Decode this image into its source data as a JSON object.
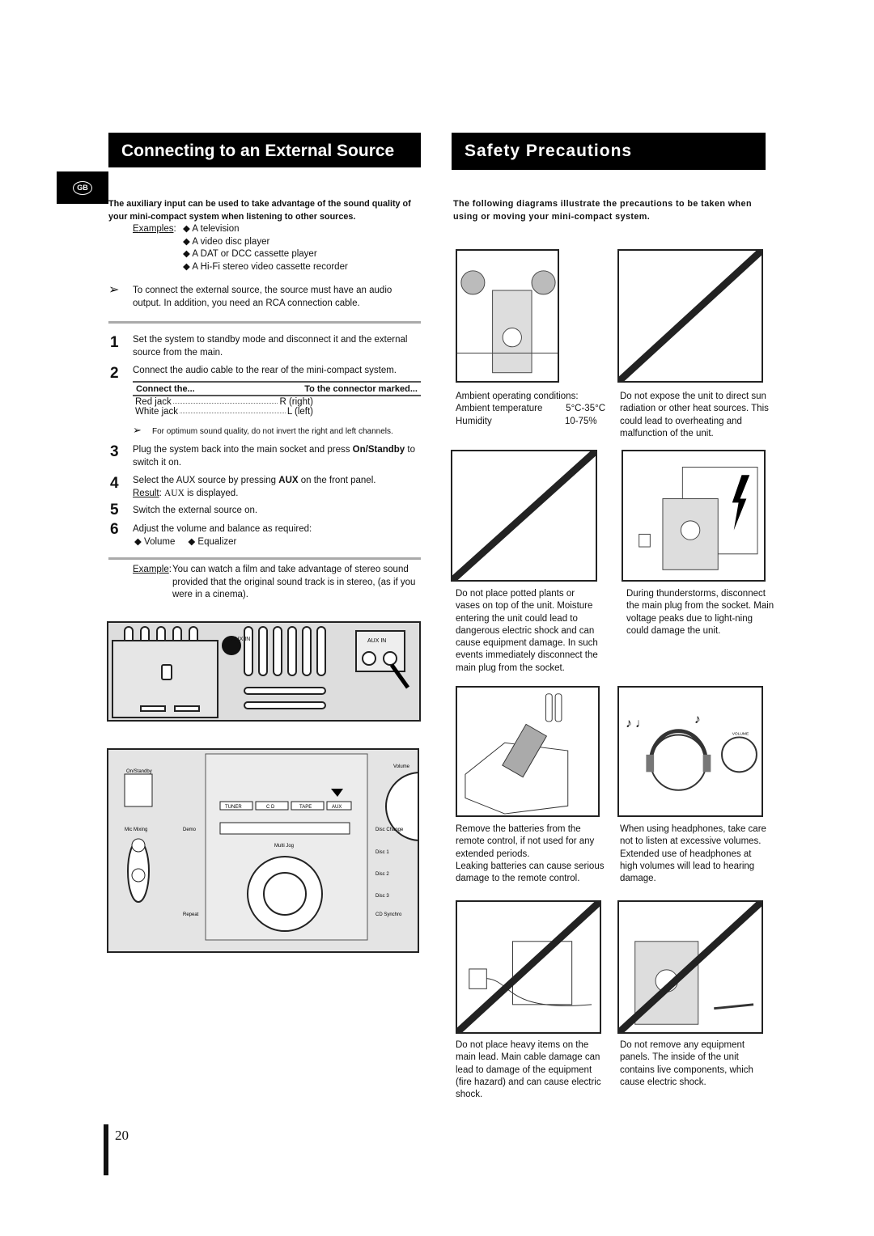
{
  "left": {
    "title": "Connecting to an External Source",
    "lang_badge": "GB",
    "intro": "The auxiliary input can be used to take advantage of the sound quality of your mini-compact system when listening to other sources.",
    "examples_label": "Examples",
    "examples": [
      "A television",
      "A video disc player",
      "A DAT or DCC cassette player",
      "A Hi-Fi stereo video cassette recorder"
    ],
    "note1": "To connect the external source, the source must have an audio output. In addition, you need an RCA connection cable.",
    "steps": [
      {
        "n": "1",
        "text": "Set the system to standby mode and disconnect it and the external source from the main."
      },
      {
        "n": "2",
        "text": "Connect the audio cable to the rear of the mini-compact system."
      },
      {
        "n": "3",
        "text_a": "Plug the system back into the main socket and press ",
        "bold": "On/Standby",
        "text_b": " to switch it on."
      },
      {
        "n": "4",
        "text_a": "Select the AUX source by pressing ",
        "bold": "AUX",
        "text_b": " on the front panel."
      },
      {
        "n": "5",
        "text": "Switch the external source on."
      },
      {
        "n": "6",
        "text": "Adjust the volume and balance as required:"
      }
    ],
    "table": {
      "col1": "Connect the...",
      "col2": "To the connector marked...",
      "rows": [
        [
          "Red jack",
          "R (right)"
        ],
        [
          "White jack",
          "L (left)"
        ]
      ]
    },
    "note2": "For optimum sound quality, do not invert the right and left channels.",
    "result_label": "Result",
    "result_bold": "AUX",
    "result_text": " is displayed.",
    "adjust_items": [
      "Volume",
      "Equalizer"
    ],
    "example_label": "Example",
    "example_text": "You can watch a film and take advantage of stereo sound provided that the original sound track is in stereo, (as if you were in a cinema).",
    "rear_panel": {
      "aux_in": "AUX IN",
      "r": "R",
      "l": "L"
    },
    "front_panel": {
      "buttons": [
        "TUNER",
        "C D",
        "TAPE",
        "AUX"
      ],
      "labels": [
        "On/Standby",
        "Volume",
        "Demo",
        "Disc Change",
        "Mic Mixing",
        "Disc 1",
        "Disc 2",
        "Disc 3",
        "Repeat",
        "CD Synchro",
        "Multi Jog"
      ]
    }
  },
  "right": {
    "title": "Safety Precautions",
    "intro": "The following diagrams illustrate the precautions to be taken when using or moving your mini-compact system.",
    "conditions": {
      "heading": "Ambient operating conditions:",
      "rows": [
        [
          "Ambient temperature",
          "5°C-35°C"
        ],
        [
          "Humidity",
          "10-75%"
        ]
      ]
    },
    "captions": [
      "Do not expose the unit to direct sun radiation or other heat sources. This could lead to overheating and malfunction of the unit.",
      "Do not place potted plants or vases on top of the unit. Moisture entering the unit could lead to dangerous electric shock and can cause equipment damage. In such events immediately disconnect the main plug from the socket.",
      "During thunderstorms, disconnect the main plug from the socket. Main voltage peaks due to light-ning could damage the unit.",
      "Remove the batteries from the remote control, if not used for any extended periods.",
      "Leaking batteries can cause serious damage to the remote control.",
      "When using headphones, take care not to listen at excessive volumes. Extended use of headphones at high volumes will lead to hearing damage.",
      "Do not place heavy items on the main lead. Main cable damage can lead to damage of the equipment (fire hazard) and can cause electric shock.",
      "Do not remove any equipment panels. The inside of the unit",
      "contains live components, which cause electric shock."
    ],
    "volume_label": "VOLUME"
  },
  "page_number": "20"
}
